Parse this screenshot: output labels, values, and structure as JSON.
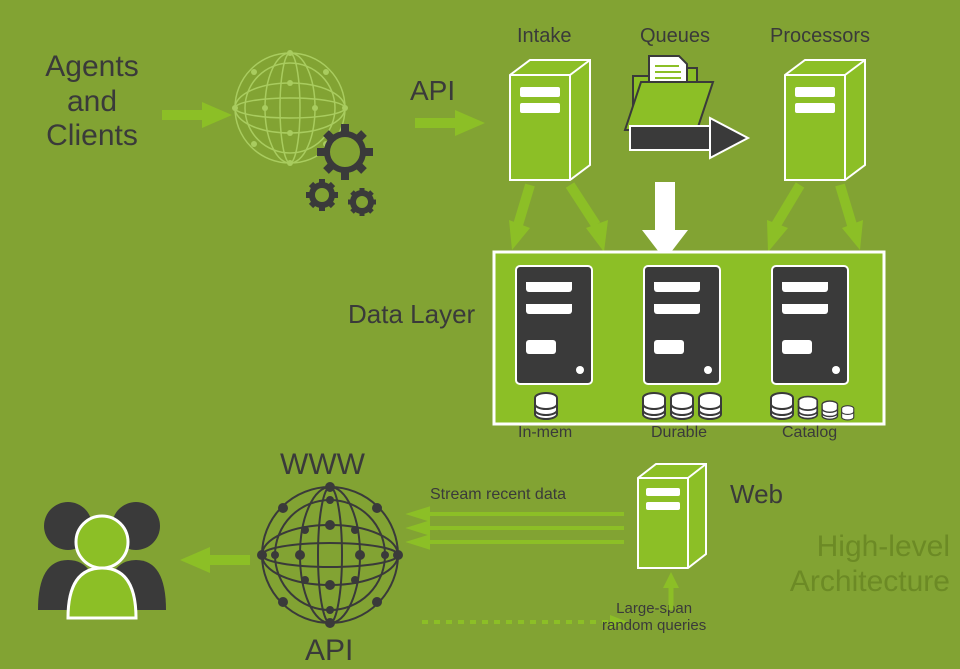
{
  "nodes": {
    "agentsClients": "Agents\nand\nClients",
    "api1": "API",
    "intake": "Intake",
    "queues": "Queues",
    "processors": "Processors",
    "dataLayer": "Data Layer",
    "inMem": "In-mem",
    "durable": "Durable",
    "catalog": "Catalog",
    "www": "WWW",
    "api2": "API",
    "web": "Web",
    "streamRecent": "Stream recent data",
    "largeSpan": "Large-span\nrandom queries"
  },
  "title": "High-level\nArchitecture"
}
